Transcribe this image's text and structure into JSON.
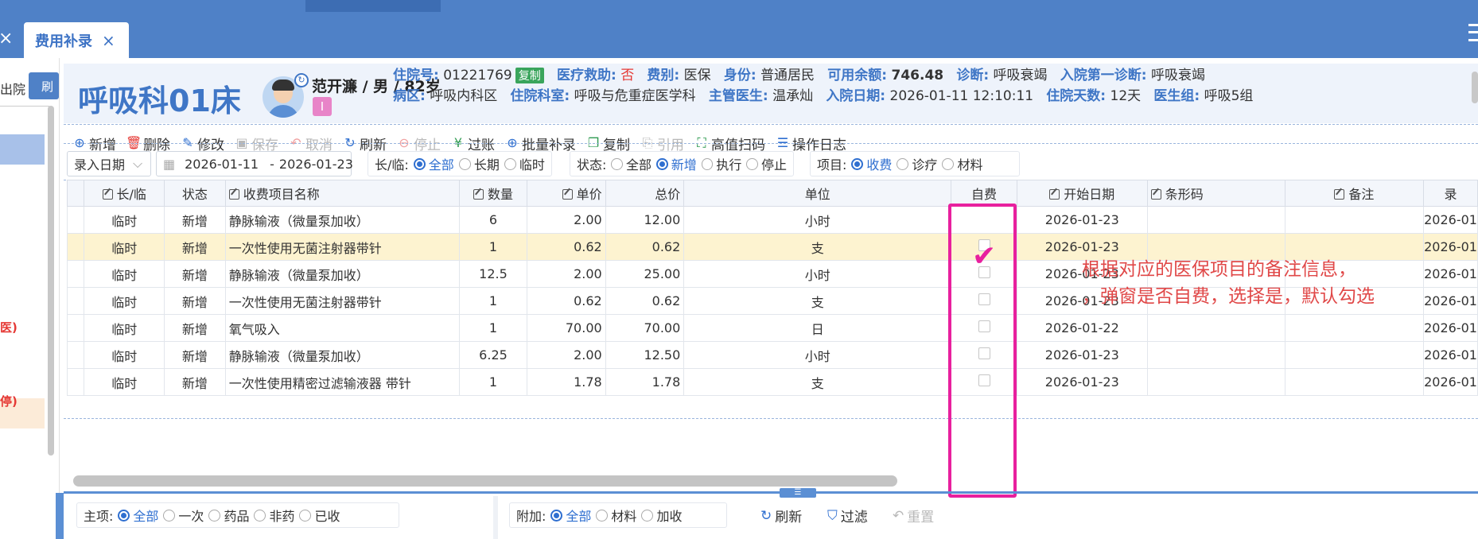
{
  "tabs": {
    "active_label": "费用补录",
    "close_glyph": "×"
  },
  "left_panel": {
    "label": "出院",
    "button_label": "刷",
    "red_text_1": "医)",
    "red_text_2": "停)"
  },
  "patient": {
    "bed": "呼吸科01床",
    "name_line": "范开濂 / 男 / 82岁",
    "badge": "I",
    "row1": [
      {
        "key": "住院号:",
        "value": "01221769"
      },
      {
        "key": "医疗救助:",
        "value": "否"
      },
      {
        "key": "费别:",
        "value": "医保"
      },
      {
        "key": "身份:",
        "value": "普通居民"
      },
      {
        "key": "可用余额:",
        "value": "746.48"
      },
      {
        "key": "诊断:",
        "value": "呼吸衰竭"
      },
      {
        "key": "入院第一诊断:",
        "value": "呼吸衰竭"
      }
    ],
    "copy_tag": "复制",
    "row2": [
      {
        "key": "病区:",
        "value": "呼吸内科区"
      },
      {
        "key": "住院科室:",
        "value": "呼吸与危重症医学科"
      },
      {
        "key": "主管医生:",
        "value": "温承灿"
      },
      {
        "key": "入院日期:",
        "value": "2026-01-11 12:10:11"
      },
      {
        "key": "住院天数:",
        "value": "12天"
      },
      {
        "key": "医生组:",
        "value": "呼吸5组"
      }
    ]
  },
  "toolbar": {
    "add": "新增",
    "delete": "删除",
    "edit": "修改",
    "save": "保存",
    "cancel": "取消",
    "refresh": "刷新",
    "stop": "停止",
    "post": "过账",
    "batch": "批量补录",
    "copy": "复制",
    "reference": "引用",
    "scan": "高值扫码",
    "log": "操作日志"
  },
  "filters": {
    "date_type": "录入日期",
    "date_from": "2026-01-11",
    "date_sep": "-",
    "date_to": "2026-01-23",
    "long_temp_label": "长/临:",
    "long_temp_options": [
      "全部",
      "长期",
      "临时"
    ],
    "status_label": "状态:",
    "status_options": [
      "全部",
      "新增",
      "执行",
      "停止"
    ],
    "item_label": "项目:",
    "item_options": [
      "收费",
      "诊疗",
      "材料"
    ]
  },
  "table": {
    "headers": {
      "long_temp": "长/临",
      "status": "状态",
      "item_name": "收费项目名称",
      "qty": "数量",
      "unit_price": "单价",
      "total": "总价",
      "unit": "单位",
      "self_pay": "自费",
      "start_date": "开始日期",
      "barcode": "条形码",
      "remark": "备注",
      "last": "录"
    },
    "rows": [
      {
        "type": "临时",
        "status": "新增",
        "name": "静脉输液（微量泵加收）",
        "qty": "6",
        "price": "2.00",
        "total": "12.00",
        "unit": "小时",
        "date": "2026-01-23",
        "last": "2026-01",
        "self_pay": true
      },
      {
        "type": "临时",
        "status": "新增",
        "name": "一次性使用无菌注射器带针",
        "qty": "1",
        "price": "0.62",
        "total": "0.62",
        "unit": "支",
        "date": "2026-01-23",
        "last": "2026-01",
        "self_pay": false
      },
      {
        "type": "临时",
        "status": "新增",
        "name": "静脉输液（微量泵加收）",
        "qty": "12.5",
        "price": "2.00",
        "total": "25.00",
        "unit": "小时",
        "date": "2026-01-23",
        "last": "2026-01",
        "self_pay": false
      },
      {
        "type": "临时",
        "status": "新增",
        "name": "一次性使用无菌注射器带针",
        "qty": "1",
        "price": "0.62",
        "total": "0.62",
        "unit": "支",
        "date": "2026-01-23",
        "last": "2026-01",
        "self_pay": false
      },
      {
        "type": "临时",
        "status": "新增",
        "name": "氧气吸入",
        "qty": "1",
        "price": "70.00",
        "total": "70.00",
        "unit": "日",
        "date": "2026-01-22",
        "last": "2026-01",
        "self_pay": false
      },
      {
        "type": "临时",
        "status": "新增",
        "name": "静脉输液（微量泵加收）",
        "qty": "6.25",
        "price": "2.00",
        "total": "12.50",
        "unit": "小时",
        "date": "2026-01-23",
        "last": "2026-01",
        "self_pay": false
      },
      {
        "type": "临时",
        "status": "新增",
        "name": "一次性使用精密过滤输液器 带针",
        "qty": "1",
        "price": "1.78",
        "total": "1.78",
        "unit": "支",
        "date": "2026-01-23",
        "last": "2026-01",
        "self_pay": false
      }
    ]
  },
  "annotation": {
    "line1": "根据对应的医保项目的备注信息，",
    "line2": "，弹窗是否自费，选择是，默认勾选"
  },
  "bottom": {
    "main_label": "主项:",
    "main_options": [
      "全部",
      "一次",
      "药品",
      "非药",
      "已收"
    ],
    "extra_label": "附加:",
    "extra_options": [
      "全部",
      "材料",
      "加收"
    ],
    "refresh": "刷新",
    "filter": "过滤",
    "reset": "重置"
  },
  "colors": {
    "brand": "#4f81c7",
    "highlight": "#e8209e",
    "annotation": "#e04848",
    "selected_row": "#fdf3d0"
  }
}
